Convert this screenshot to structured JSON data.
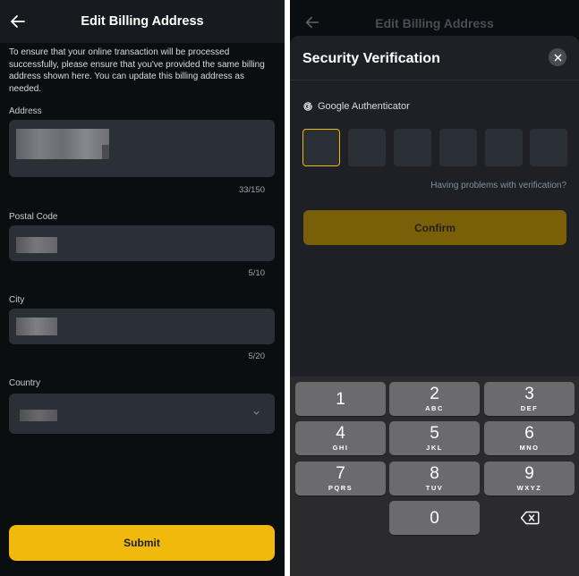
{
  "left": {
    "title": "Edit Billing Address",
    "intro": "To ensure that your online transaction will be processed successfully, please ensure that you've provided the same billing address shown here. You can update this billing address as needed.",
    "fields": {
      "address": {
        "label": "Address",
        "counter": "33/150"
      },
      "postal": {
        "label": "Postal Code",
        "counter": "5/10"
      },
      "city": {
        "label": "City",
        "counter": "5/20"
      },
      "country": {
        "label": "Country"
      }
    },
    "submit_label": "Submit",
    "colors": {
      "accent": "#f0b90b",
      "background": "#0b0e11",
      "field": "#2b2f36"
    }
  },
  "right": {
    "background_title": "Edit Billing Address",
    "sheet_title": "Security Verification",
    "authenticator_label": "Google Authenticator",
    "problem_link": "Having problems with verification?",
    "confirm_label": "Confirm",
    "code_box_count": 6,
    "keys": [
      {
        "num": "1",
        "letters": ""
      },
      {
        "num": "2",
        "letters": "ABC"
      },
      {
        "num": "3",
        "letters": "DEF"
      },
      {
        "num": "4",
        "letters": "GHI"
      },
      {
        "num": "5",
        "letters": "JKL"
      },
      {
        "num": "6",
        "letters": "MNO"
      },
      {
        "num": "7",
        "letters": "PQRS"
      },
      {
        "num": "8",
        "letters": "TUV"
      },
      {
        "num": "9",
        "letters": "WXYZ"
      },
      {
        "num": "0",
        "letters": ""
      }
    ],
    "icons": [
      "close-icon",
      "google-icon",
      "backspace-icon",
      "back-arrow-icon"
    ]
  }
}
